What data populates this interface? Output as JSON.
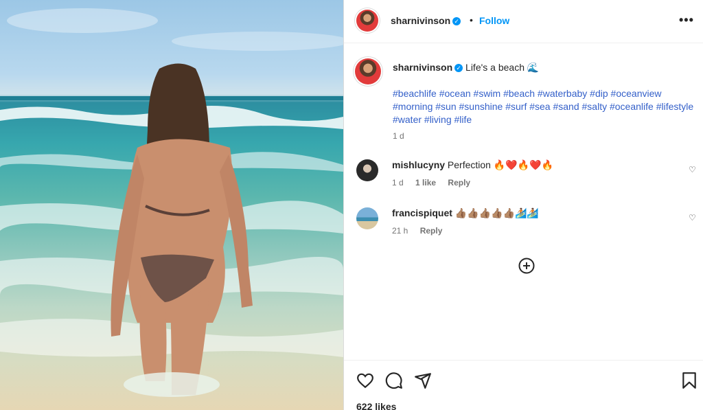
{
  "post": {
    "image_alt": "Woman walking into the ocean surf",
    "author": {
      "username": "sharnivinson",
      "verified": true,
      "follow_label": "Follow",
      "separator": "•",
      "more_label": "•••"
    },
    "caption": {
      "username": "sharnivinson",
      "text": "Life's a beach 🌊",
      "hashtags": "#beachlife #ocean #swim #beach #waterbaby #dip #oceanview #morning #sun #sunshine #surf #sea #sand #salty #oceanlife #lifestyle #water #living #life",
      "time": "1 d"
    },
    "comments": [
      {
        "username": "mishlucyny",
        "text": "Perfection 🔥❤️🔥❤️🔥",
        "time": "1 d",
        "likes": "1 like",
        "reply_label": "Reply"
      },
      {
        "username": "francispiquet",
        "text": "👍🏽👍🏽👍🏽👍🏽👍🏽🏄🏽🏄🏽",
        "time": "21 h",
        "likes": "",
        "reply_label": "Reply"
      }
    ],
    "likes_label": "622 likes",
    "colors": {
      "accent": "#0095f6",
      "hashtag": "#3460c9",
      "muted": "#737373"
    }
  }
}
